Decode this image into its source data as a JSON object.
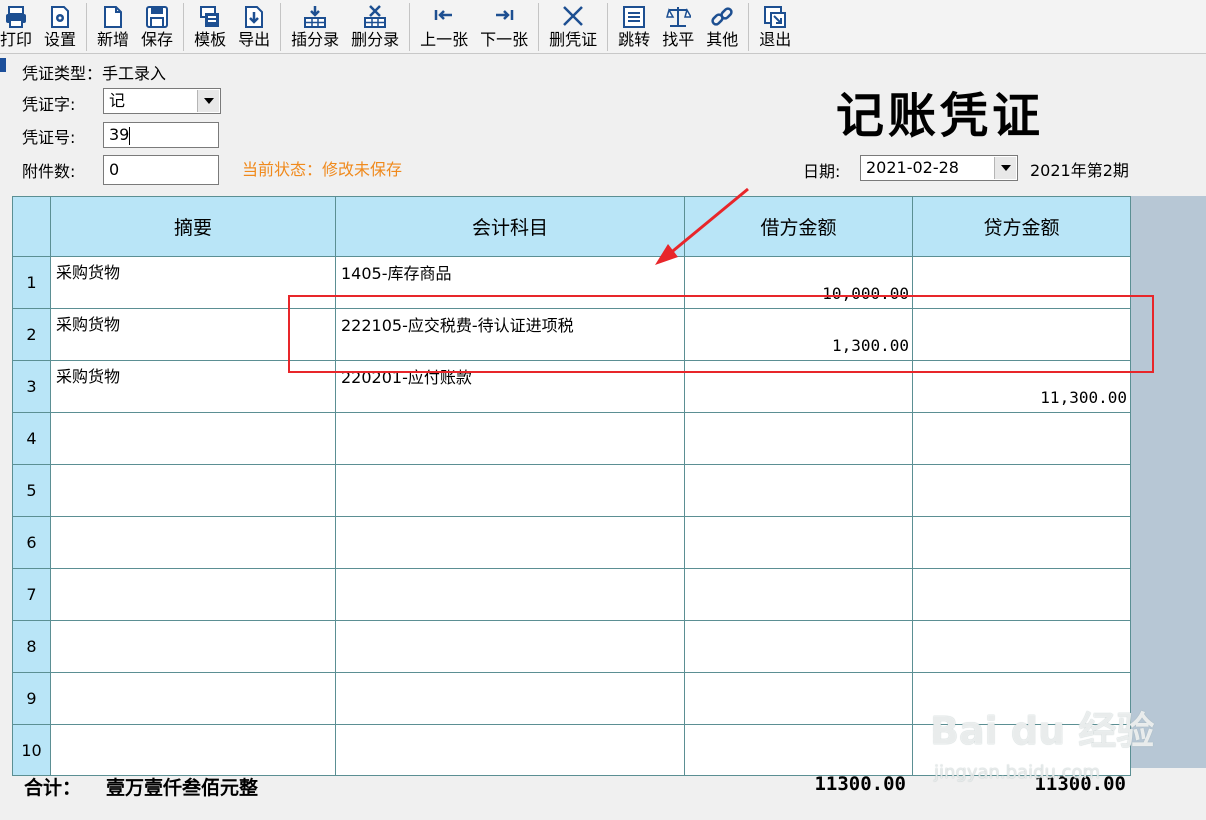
{
  "toolbar": {
    "buttons": [
      {
        "label": "打印",
        "icon": "printer-icon"
      },
      {
        "label": "设置",
        "icon": "settings-icon"
      },
      {
        "label": "新增",
        "icon": "new-document-icon"
      },
      {
        "label": "保存",
        "icon": "save-icon"
      },
      {
        "label": "模板",
        "icon": "template-icon"
      },
      {
        "label": "导出",
        "icon": "export-icon"
      },
      {
        "label": "插分录",
        "icon": "insert-entry-icon"
      },
      {
        "label": "删分录",
        "icon": "delete-entry-icon"
      },
      {
        "label": "上一张",
        "icon": "previous-icon"
      },
      {
        "label": "下一张",
        "icon": "next-icon"
      },
      {
        "label": "删凭证",
        "icon": "delete-voucher-icon"
      },
      {
        "label": "跳转",
        "icon": "jump-icon"
      },
      {
        "label": "找平",
        "icon": "balance-scale-icon"
      },
      {
        "label": "其他",
        "icon": "link-icon"
      },
      {
        "label": "退出",
        "icon": "exit-icon"
      }
    ]
  },
  "header": {
    "voucher_type_label": "凭证类型：",
    "voucher_type_value": "手工录入",
    "voucher_word_label": "凭证字:",
    "voucher_word_value": "记",
    "voucher_no_label": "凭证号:",
    "voucher_no_value": "39",
    "attachments_label": "附件数:",
    "attachments_value": "0",
    "status": "当前状态：修改未保存",
    "title": "记账凭证",
    "date_label": "日期:",
    "date_value": "2021-02-28",
    "period": "2021年第2期"
  },
  "grid": {
    "columns": [
      "摘要",
      "会计科目",
      "借方金额",
      "贷方金额"
    ],
    "rows": [
      {
        "no": "1",
        "summary": "采购货物",
        "account": "1405-库存商品",
        "debit": "10,000.00",
        "credit": ""
      },
      {
        "no": "2",
        "summary": "采购货物",
        "account": "222105-应交税费-待认证进项税",
        "debit": "1,300.00",
        "credit": ""
      },
      {
        "no": "3",
        "summary": "采购货物",
        "account": "220201-应付账款",
        "debit": "",
        "credit": "11,300.00"
      },
      {
        "no": "4",
        "summary": "",
        "account": "",
        "debit": "",
        "credit": ""
      },
      {
        "no": "5",
        "summary": "",
        "account": "",
        "debit": "",
        "credit": ""
      },
      {
        "no": "6",
        "summary": "",
        "account": "",
        "debit": "",
        "credit": ""
      },
      {
        "no": "7",
        "summary": "",
        "account": "",
        "debit": "",
        "credit": ""
      },
      {
        "no": "8",
        "summary": "",
        "account": "",
        "debit": "",
        "credit": ""
      },
      {
        "no": "9",
        "summary": "",
        "account": "",
        "debit": "",
        "credit": ""
      },
      {
        "no": "10",
        "summary": "",
        "account": "",
        "debit": "",
        "credit": ""
      }
    ]
  },
  "totals": {
    "label": "合计：",
    "amount_words": "壹万壹仟叁佰元整",
    "debit_total": "11300.00",
    "credit_total": "11300.00"
  },
  "watermark": {
    "brand": "Bai du 经验",
    "site": "jingyan.baidu.com"
  },
  "colors": {
    "grid_header_bg": "#b9e5f7",
    "grid_border": "#5b8f93",
    "status_text": "#f08a1d",
    "annotation_red": "#e8262a"
  }
}
